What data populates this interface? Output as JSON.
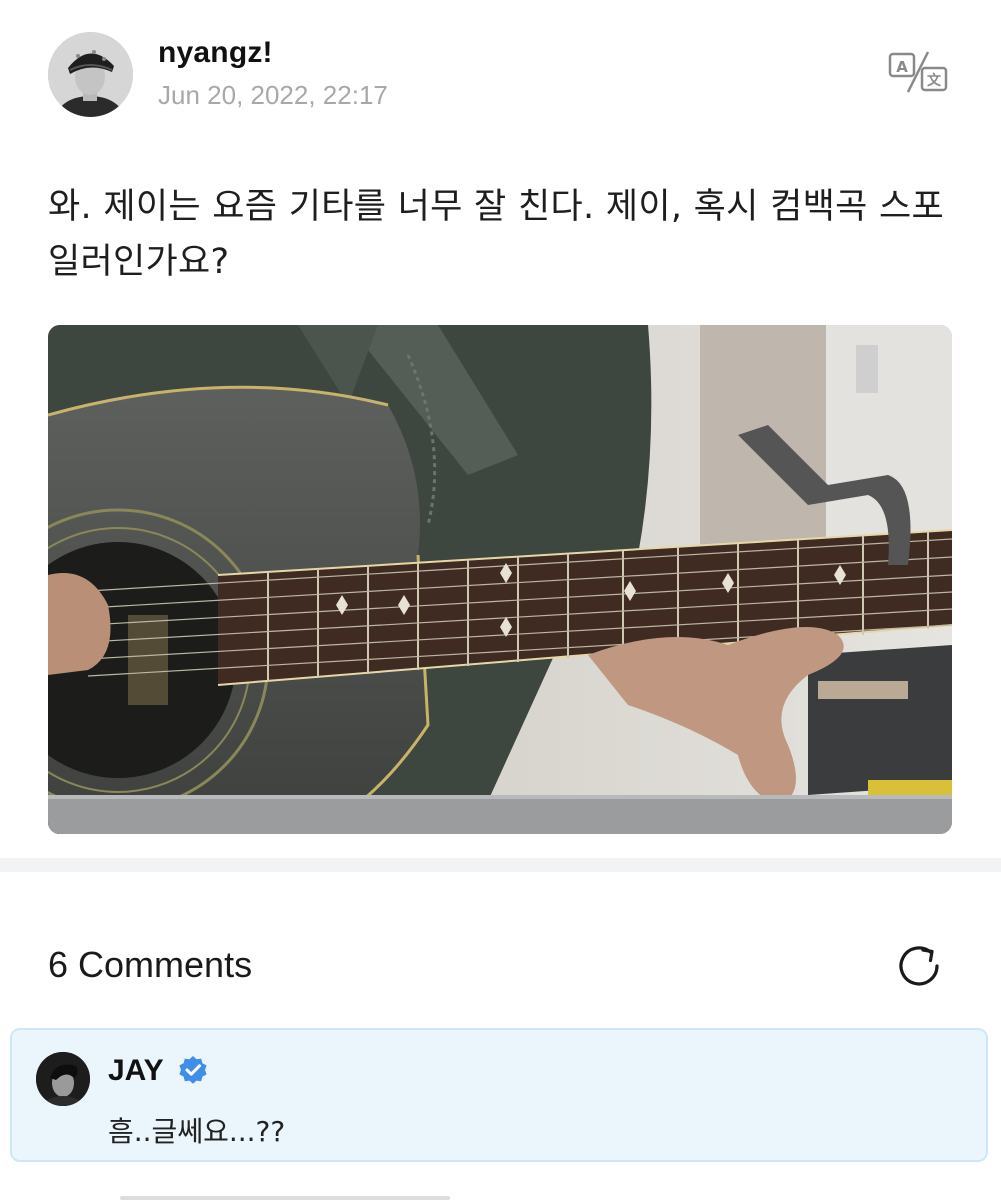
{
  "post": {
    "author": {
      "name": "nyangz!",
      "avatar_icon": "user-avatar-photo"
    },
    "timestamp": "Jun 20, 2022, 22:17",
    "translate_icon": "translate-icon",
    "text": "와. 제이는 요즘 기타를 너무 잘 친다. 제이, 혹시 컴백곡 스포일러인가요?",
    "media": {
      "type": "photo",
      "icon": "guitar-photo"
    }
  },
  "comments": {
    "count_label": "6 Comments",
    "refresh_icon": "refresh-icon",
    "items": [
      {
        "author": "JAY",
        "verified": true,
        "verified_icon": "verified-badge-icon",
        "text": "흠..글쎄요...??"
      }
    ]
  },
  "colors": {
    "comment_highlight_bg": "#eaf6fc",
    "comment_highlight_border": "#cfe7f4",
    "verified_blue": "#3f8ee8",
    "timestamp_gray": "#a8a8a8",
    "divider_gray": "#f2f3f5"
  }
}
